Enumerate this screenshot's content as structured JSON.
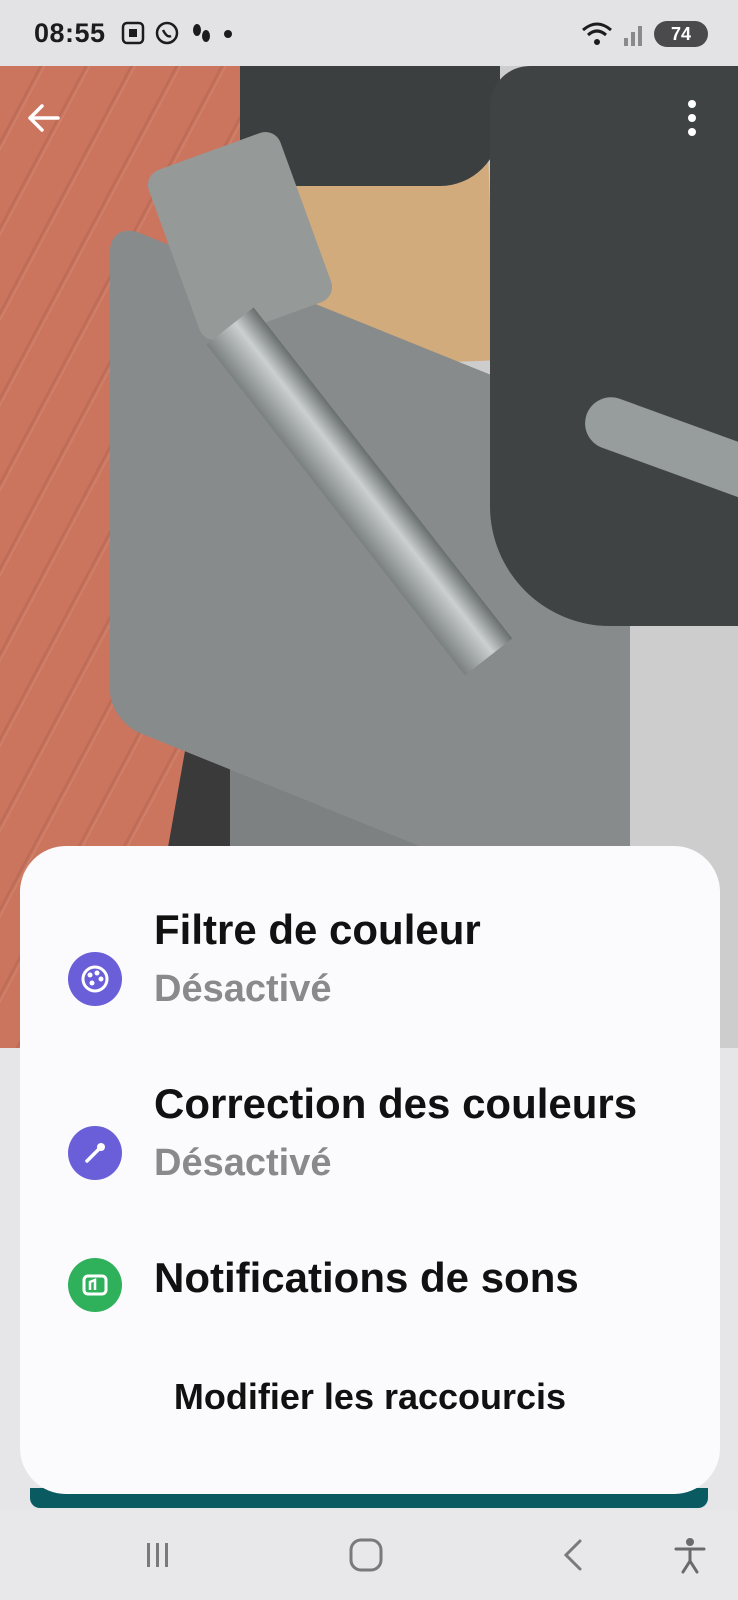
{
  "status_bar": {
    "time": "08:55",
    "battery": "74"
  },
  "icons": {
    "back": "back-arrow-icon",
    "menu": "more-vertical-icon",
    "color_filter": "palette-icon",
    "color_correction": "eyedropper-icon",
    "sound_notifications": "sound-notification-icon",
    "nav_recents": "recents-icon",
    "nav_home": "home-icon",
    "nav_back": "back-icon",
    "nav_accessibility": "accessibility-icon"
  },
  "colors": {
    "purple_icon": "#6a5fd8",
    "green_icon": "#2fb05a",
    "teal_strip": "#0a5a62"
  },
  "dialog": {
    "items": [
      {
        "title": "Filtre de couleur",
        "subtitle": "Désactivé"
      },
      {
        "title": "Correction des couleurs",
        "subtitle": "Désactivé"
      },
      {
        "title": "Notifications de sons"
      }
    ],
    "edit_shortcuts": "Modifier les raccourcis"
  }
}
